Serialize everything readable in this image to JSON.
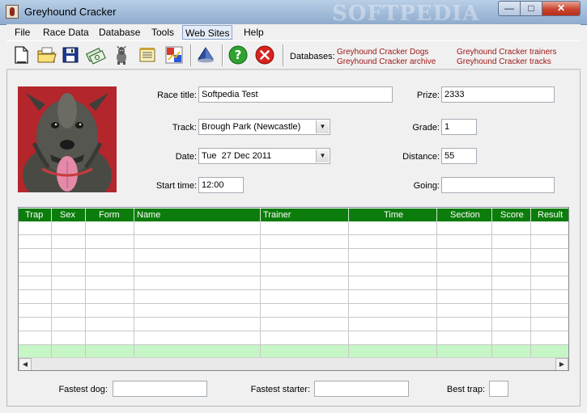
{
  "window": {
    "title": "Greyhound Cracker",
    "watermark": "SOFTPEDIA",
    "controls": {
      "minimize": "—",
      "maximize": "□",
      "close": "✕"
    }
  },
  "menu": [
    {
      "label": "File"
    },
    {
      "label": "Race Data"
    },
    {
      "label": "Database"
    },
    {
      "label": "Tools"
    },
    {
      "label": "Web Sites",
      "active": true
    },
    {
      "label": "Help"
    }
  ],
  "toolbar": {
    "icons": [
      "new-document-icon",
      "open-folder-icon",
      "save-disk-icon",
      "money-icon",
      "greyhound-icon",
      "notepad-icon",
      "race-card-icon",
      "pyramid-icon",
      "help-icon",
      "cancel-icon"
    ],
    "databases_label": "Databases:",
    "links": {
      "dogs": "Greyhound Cracker Dogs",
      "archive": "Greyhound Cracker archive",
      "trainers": "Greyhound Cracker trainers",
      "tracks": "Greyhound Cracker tracks"
    }
  },
  "form": {
    "race_title": {
      "label": "Race title:",
      "value": "Softpedia Test"
    },
    "track": {
      "label": "Track:",
      "value": "Brough Park (Newcastle)"
    },
    "date": {
      "label": "Date:",
      "value": "Tue  27 Dec 2011"
    },
    "start_time": {
      "label": "Start time:",
      "value": "12:00"
    },
    "prize": {
      "label": "Prize:",
      "value": "2333"
    },
    "grade": {
      "label": "Grade:",
      "value": "1"
    },
    "distance": {
      "label": "Distance:",
      "value": "55"
    },
    "going": {
      "label": "Going:",
      "value": ""
    }
  },
  "grid": {
    "columns": [
      "Trap",
      "Sex",
      "Form",
      "Name",
      "Trainer",
      "Time",
      "Section",
      "Score",
      "Result"
    ],
    "rows": 10,
    "highlighted_row": 10
  },
  "footer": {
    "fastest_dog": {
      "label": "Fastest dog:",
      "value": ""
    },
    "fastest_starter": {
      "label": "Fastest starter:",
      "value": ""
    },
    "best_trap": {
      "label": "Best trap:",
      "value": ""
    }
  },
  "colors": {
    "grid_header": "#0c7c0c",
    "link": "#9c1414",
    "highlight_row": "#c6f5c6"
  }
}
